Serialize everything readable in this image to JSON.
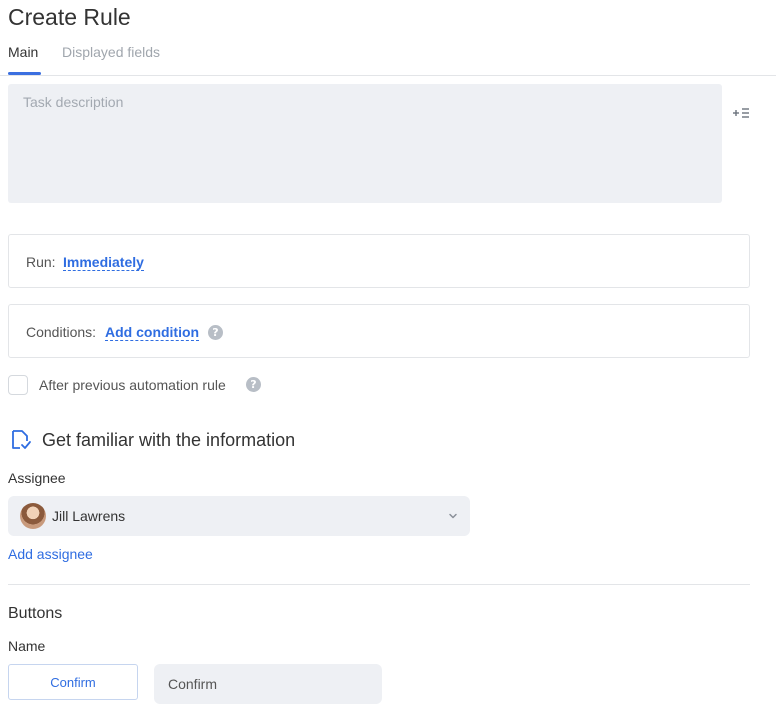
{
  "page": {
    "title": "Create Rule"
  },
  "tabs": [
    {
      "label": "Main",
      "active": true
    },
    {
      "label": "Displayed fields",
      "active": false
    }
  ],
  "description": {
    "placeholder": "Task description",
    "value": ""
  },
  "run": {
    "label": "Run:",
    "value": "Immediately"
  },
  "conditions": {
    "label": "Conditions:",
    "link": "Add condition"
  },
  "after_previous": {
    "label": "After previous automation rule",
    "checked": false
  },
  "section": {
    "title": "Get familiar with the information",
    "icon": "document-check-icon"
  },
  "assignee": {
    "label": "Assignee",
    "selected": "Jill Lawrens",
    "add_link": "Add assignee"
  },
  "buttons": {
    "title": "Buttons",
    "name_label": "Name",
    "confirm_label": "Confirm",
    "name_value": "Confirm"
  },
  "colors": {
    "accent": "#2f6de1",
    "input_bg": "#eef0f4",
    "border": "#e3e5e8",
    "muted_text": "#a0a6ad"
  }
}
